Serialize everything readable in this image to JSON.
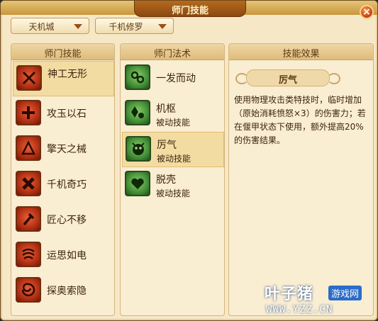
{
  "window": {
    "title": "师门技能",
    "close_label": "×"
  },
  "filters": {
    "school": "天机城",
    "branch": "千机修罗"
  },
  "left_panel": {
    "header": "师门技能",
    "items": [
      {
        "name": "神工无形",
        "icon": "crossed-blades-icon"
      },
      {
        "name": "攻玉以石",
        "icon": "stone-cross-icon"
      },
      {
        "name": "擎天之械",
        "icon": "mechanism-icon"
      },
      {
        "name": "千机奇巧",
        "icon": "x-cross-icon"
      },
      {
        "name": "匠心不移",
        "icon": "hammer-icon"
      },
      {
        "name": "运思如电",
        "icon": "swirl-icon"
      },
      {
        "name": "探奥索隐",
        "icon": "vortex-icon"
      }
    ]
  },
  "middle_panel": {
    "header": "师门法术",
    "items": [
      {
        "name": "一发而动",
        "sub": "",
        "icon": "gears-icon"
      },
      {
        "name": "机枢",
        "sub": "被动技能",
        "icon": "crystal-icon"
      },
      {
        "name": "厉气",
        "sub": "被动技能",
        "icon": "fierce-face-icon"
      },
      {
        "name": "脱壳",
        "sub": "被动技能",
        "icon": "heart-shell-icon"
      }
    ]
  },
  "right_panel": {
    "header": "技能效果",
    "skill_name": "厉气",
    "description": "使用物理攻击类特技时，临时增加（原始消耗愤怒×3）的伤害力；若在偃甲状态下使用，额外提高20%的伤害结果。"
  },
  "watermark": {
    "brand": "叶子猪",
    "tag": "游戏网",
    "url": "WWW.YZZ.CN"
  },
  "colors": {
    "accent": "#a8541a",
    "selected_row": "#f3dca2",
    "panel_bg": "#f9edd2"
  }
}
